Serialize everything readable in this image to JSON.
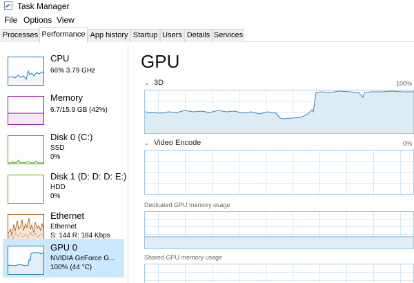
{
  "window": {
    "title": "Task Manager",
    "icon": "task-manager-icon"
  },
  "menu": [
    "File",
    "Options",
    "View"
  ],
  "tabs": [
    "Processes",
    "Performance",
    "App history",
    "Startup",
    "Users",
    "Details",
    "Services"
  ],
  "active_tab": "Performance",
  "sidebar": {
    "items": [
      {
        "name": "CPU",
        "line1": "66%  3.79 GHz",
        "line2": "",
        "line3": "",
        "color": "#117dbb",
        "selected": false
      },
      {
        "name": "Memory",
        "line1": "6.7/15.9 GB (42%)",
        "line2": "",
        "line3": "",
        "color": "#8b12ae",
        "selected": false
      },
      {
        "name": "Disk 0 (C:)",
        "line1": "SSD",
        "line2": "0%",
        "line3": "",
        "color": "#4da60c",
        "selected": false
      },
      {
        "name": "Disk 1 (D: D: D: E:)",
        "line1": "HDD",
        "line2": "0%",
        "line3": "",
        "color": "#4da60c",
        "selected": false
      },
      {
        "name": "Ethernet",
        "line1": "Ethernet",
        "line2": "S: 144  R: 184 Kbps",
        "line3": "",
        "color": "#a74f01",
        "selected": false
      },
      {
        "name": "GPU 0",
        "line1": "NVIDIA GeForce G...",
        "line2": "100%  (44 °C)",
        "line3": "",
        "color": "#117dbb",
        "selected": true
      }
    ]
  },
  "main": {
    "title": "GPU",
    "engine_3d": {
      "label": "3D",
      "percent": "100%"
    },
    "video_encode": {
      "label": "Video Encode",
      "percent": "0%"
    },
    "dedicated_memory_label": "Dedicated GPU memory usage",
    "shared_memory_label": "Shared GPU memory usage"
  },
  "colors": {
    "gpu_line": "#2b7bb9",
    "gpu_fill": "#dcebf5",
    "grid": "#cfe3f1",
    "selected_bg": "#cce8ff"
  }
}
